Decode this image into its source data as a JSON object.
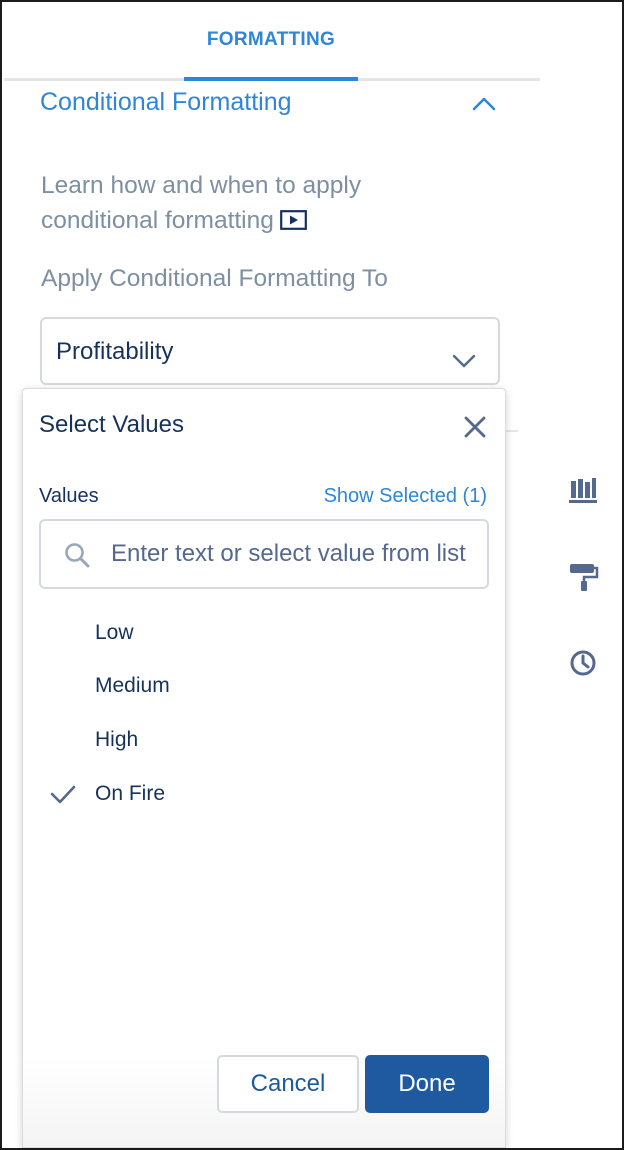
{
  "tabs": [
    {
      "label": "FORMATTING",
      "active": true
    }
  ],
  "section": {
    "title": "Conditional Formatting"
  },
  "help": {
    "text": "Learn how and when to apply conditional formatting",
    "icon": "video-play-icon"
  },
  "apply": {
    "label": "Apply Conditional Formatting To",
    "selected": "Profitability"
  },
  "side_icons": [
    "bar-chart-icon",
    "paint-roller-icon",
    "clock-icon"
  ],
  "modal": {
    "title": "Select Values",
    "values_label": "Values",
    "show_selected": "Show Selected (1)",
    "search_placeholder": "Enter text or select value from list",
    "search_value": "",
    "options": [
      {
        "label": "Low",
        "selected": false
      },
      {
        "label": "Medium",
        "selected": false
      },
      {
        "label": "High",
        "selected": false
      },
      {
        "label": "On Fire",
        "selected": true
      }
    ],
    "cancel_label": "Cancel",
    "done_label": "Done"
  },
  "colors": {
    "accent": "#2f86d8",
    "primary_button": "#1f5aa0",
    "text_dark": "#16325c",
    "text_muted": "#7d8fa2"
  }
}
